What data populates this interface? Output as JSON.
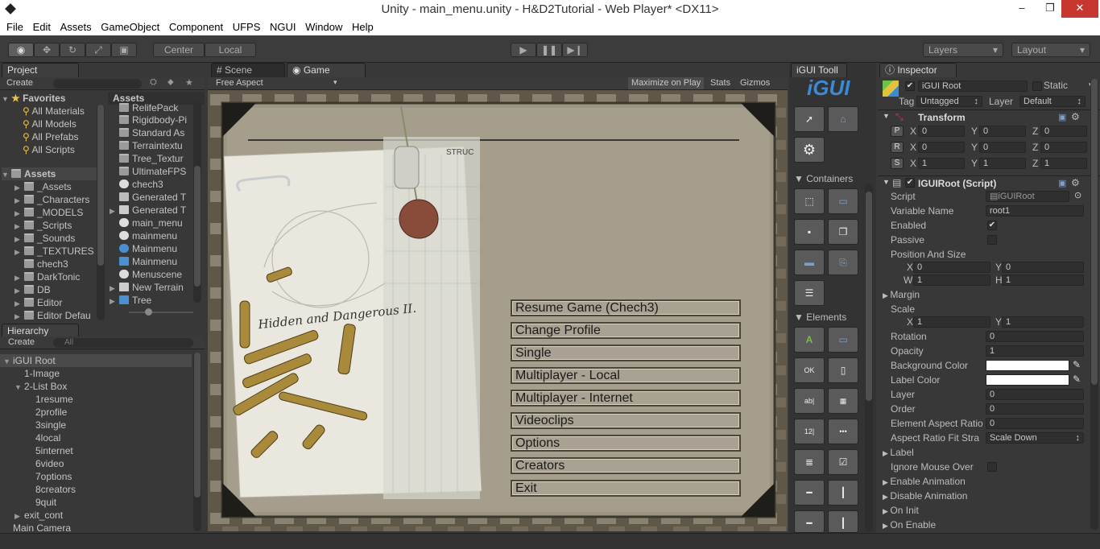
{
  "window": {
    "title": "Unity - main_menu.unity - H&D2Tutorial - Web Player* <DX11>",
    "min": "‒",
    "max": "❐",
    "close": "✕"
  },
  "menu": [
    "File",
    "Edit",
    "Assets",
    "GameObject",
    "Component",
    "UFPS",
    "NGUI",
    "Window",
    "Help"
  ],
  "toolbar": {
    "pivot": "Center",
    "space": "Local",
    "layers": "Layers",
    "layout": "Layout"
  },
  "project": {
    "tab": "Project",
    "create": "Create",
    "favorites_label": "Favorites",
    "favorites": [
      "All Materials",
      "All Models",
      "All Prefabs",
      "All Scripts"
    ],
    "assets_label": "Assets",
    "tree": [
      "_Assets",
      "_Characters",
      "_MODELS",
      "_Scripts",
      "_Sounds",
      "_TEXTURES",
      "chech3",
      "DarkTonic",
      "DB",
      "Editor",
      "Editor Defau"
    ],
    "assets_header": "Assets",
    "files": [
      "RelifePack",
      "Rigidbody-Pi",
      "Standard As",
      "Terraintextu",
      "Tree_Textur",
      "UltimateFPS",
      "chech3",
      "Generated T",
      "Generated T",
      "main_menu",
      "mainmenu",
      "Mainmenu",
      "Mainmenu",
      "Menuscene",
      "New Terrain",
      "Tree"
    ]
  },
  "hierarchy": {
    "tab": "Hierarchy",
    "create": "Create",
    "search": "All",
    "items": [
      {
        "label": "iGUI Root",
        "indent": 0,
        "fold": "▼"
      },
      {
        "label": "1-Image",
        "indent": 1,
        "fold": ""
      },
      {
        "label": "2-List Box",
        "indent": 1,
        "fold": "▼"
      },
      {
        "label": "1resume",
        "indent": 2,
        "fold": ""
      },
      {
        "label": "2profile",
        "indent": 2,
        "fold": ""
      },
      {
        "label": "3single",
        "indent": 2,
        "fold": ""
      },
      {
        "label": "4local",
        "indent": 2,
        "fold": ""
      },
      {
        "label": "5internet",
        "indent": 2,
        "fold": ""
      },
      {
        "label": "6video",
        "indent": 2,
        "fold": ""
      },
      {
        "label": "7options",
        "indent": 2,
        "fold": ""
      },
      {
        "label": "8creators",
        "indent": 2,
        "fold": ""
      },
      {
        "label": "9quit",
        "indent": 2,
        "fold": ""
      },
      {
        "label": "exit_cont",
        "indent": 1,
        "fold": "▶"
      },
      {
        "label": "Main Camera",
        "indent": 0,
        "fold": ""
      }
    ]
  },
  "view": {
    "scene_tab": "Scene",
    "game_tab": "Game",
    "aspect": "Free Aspect",
    "maximize": "Maximize on Play",
    "stats": "Stats",
    "gizmos": "Gizmos",
    "menu_items": [
      "Resume Game (Chech3)",
      "Change Profile",
      "Single",
      "Multiplayer - Local",
      "Multiplayer - Internet",
      "Videoclips",
      "Options",
      "Creators",
      "Exit"
    ],
    "signature": "Hidden and Dangerous II.",
    "stamp": "STRUC"
  },
  "igui": {
    "tab": "iGUI Tooll",
    "logo": "iGUI",
    "containers": "Containers",
    "elements": "Elements"
  },
  "inspector": {
    "tab": "Inspector",
    "object_name": "iGUI Root",
    "static_label": "Static",
    "tag_label": "Tag",
    "tag_value": "Untagged",
    "layer_label": "Layer",
    "layer_value": "Default",
    "transform": {
      "title": "Transform",
      "rows": [
        {
          "key": "P",
          "x": "0",
          "y": "0",
          "z": "0"
        },
        {
          "key": "R",
          "x": "0",
          "y": "0",
          "z": "0"
        },
        {
          "key": "S",
          "x": "1",
          "y": "1",
          "z": "1"
        }
      ]
    },
    "script_comp": {
      "title": "IGUIRoot (Script)",
      "script_label": "Script",
      "script_value": "iGUIRoot",
      "var_label": "Variable Name",
      "var_value": "root1",
      "enabled_label": "Enabled",
      "passive_label": "Passive",
      "pos_size_label": "Position And Size",
      "pos": {
        "x": "0",
        "y": "0",
        "w": "1",
        "h": "1"
      },
      "margin_label": "Margin",
      "scale_label": "Scale",
      "scale": {
        "x": "1",
        "y": "1"
      },
      "rotation_label": "Rotation",
      "rotation": "0",
      "opacity_label": "Opacity",
      "opacity": "1",
      "bg_color_label": "Background Color",
      "label_color_label": "Label Color",
      "layer_label": "Layer",
      "layer": "0",
      "order_label": "Order",
      "order": "0",
      "aspect_label": "Element Aspect Ratio",
      "aspect": "0",
      "fit_label": "Aspect Ratio Fit Stra",
      "fit_value": "Scale Down",
      "label_label": "Label",
      "ignore_label": "Ignore Mouse Over",
      "enable_anim": "Enable Animation",
      "disable_anim": "Disable Animation",
      "on_init": "On Init",
      "on_enable": "On Enable"
    }
  },
  "colors": {
    "accent": "#3a72b0",
    "panel": "#383838",
    "paper": "#e8e6dc",
    "button": "#a9a293"
  }
}
